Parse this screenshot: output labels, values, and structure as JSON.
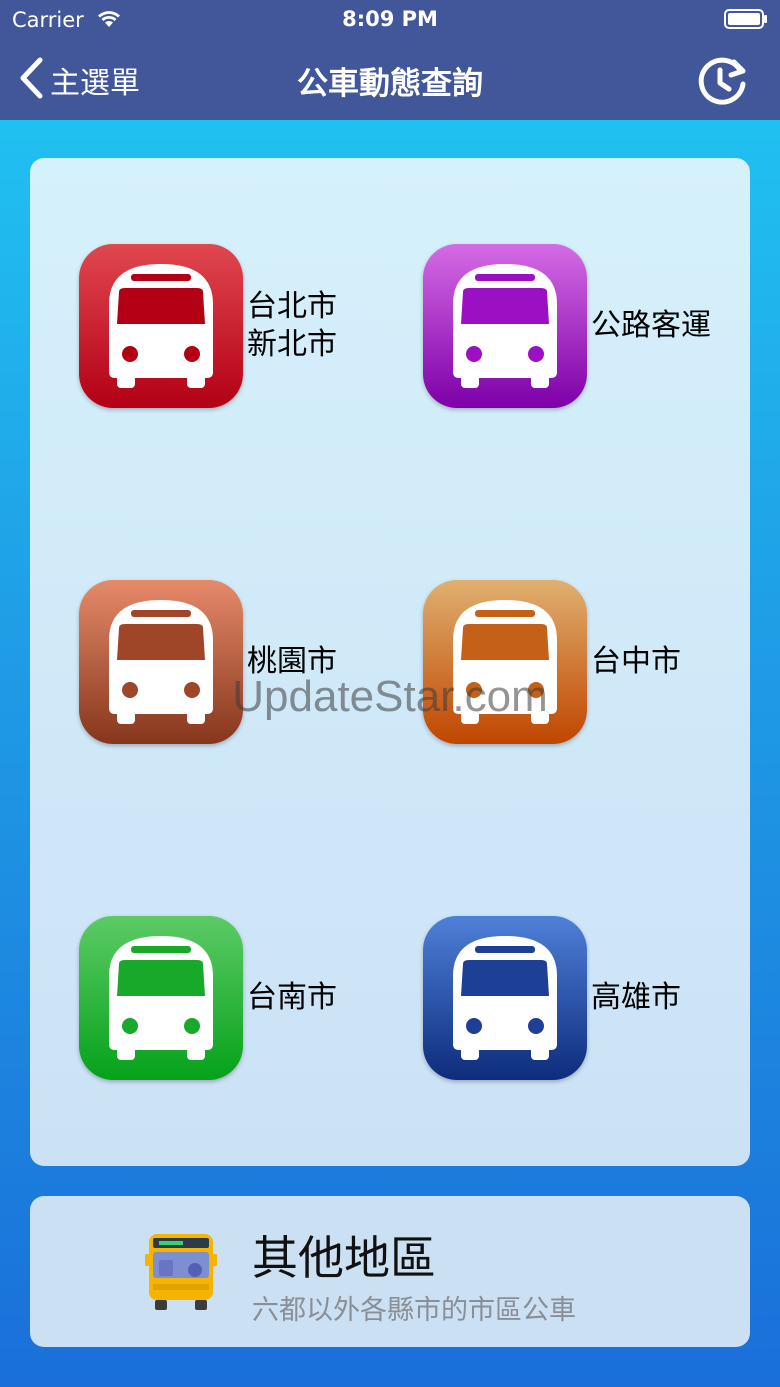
{
  "status_bar": {
    "carrier": "Carrier",
    "time": "8:09 PM"
  },
  "nav": {
    "back_label": "主選單",
    "title": "公車動態查詢"
  },
  "cities": [
    {
      "label": "台北市\n新北市",
      "color_top": "#e0474f",
      "color_bottom": "#b30015",
      "dot_color": "#b30015"
    },
    {
      "label": "公路客運",
      "color_top": "#d56be4",
      "color_bottom": "#7d00a8",
      "dot_color": "#9a10c2"
    },
    {
      "label": "桃園市",
      "color_top": "#e68a6a",
      "color_bottom": "#86361c",
      "dot_color": "#9e4627"
    },
    {
      "label": "台中市",
      "color_top": "#e0b070",
      "color_bottom": "#c04600",
      "dot_color": "#c46018"
    },
    {
      "label": "台南市",
      "color_top": "#5ccb66",
      "color_bottom": "#06a11a",
      "dot_color": "#18a82a"
    },
    {
      "label": "高雄市",
      "color_top": "#4f80d8",
      "color_bottom": "#0d2c7c",
      "dot_color": "#1d3f96"
    }
  ],
  "other_region": {
    "title": "其他地區",
    "subtitle": "六都以外各縣市的市區公車"
  },
  "watermark": "UpdateStar.com"
}
